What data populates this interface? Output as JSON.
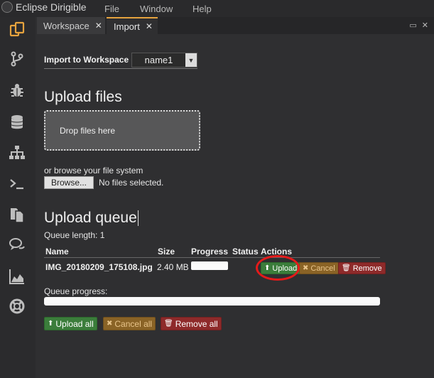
{
  "app": {
    "title": "Eclipse Dirigible"
  },
  "menu": {
    "items": [
      "File",
      "Window",
      "Help"
    ]
  },
  "leftbar": {
    "icons": [
      "workspace-icon",
      "git-branch-icon",
      "bug-icon",
      "database-icon",
      "sitemap-icon",
      "terminal-icon",
      "documents-icon",
      "chat-icon",
      "area-chart-icon",
      "lifebuoy-icon"
    ],
    "active_color": "#e6a33e"
  },
  "tabs": [
    {
      "label": "Workspace",
      "close": "✕"
    },
    {
      "label": "Import",
      "close": "✕"
    }
  ],
  "window_controls": {
    "restore": "▭",
    "close": "✕"
  },
  "import": {
    "label": "Import to Workspace",
    "workspace_value": "name1"
  },
  "upload": {
    "title": "Upload files",
    "dropzone": "Drop files here",
    "browse_prompt": "or browse your file system",
    "browse_button": "Browse...",
    "no_file": "No files selected."
  },
  "queue": {
    "title": "Upload queue",
    "length": "Queue length: 1",
    "columns": [
      "Name",
      "Size",
      "Progress",
      "Status",
      "Actions"
    ],
    "rows": [
      {
        "name": "IMG_20180209_175108.jpg",
        "size": "2.40 MB",
        "progress": 0
      }
    ],
    "row_actions": {
      "upload": "Upload",
      "cancel": "Cancel",
      "remove": "Remove"
    },
    "progress_label": "Queue progress:",
    "overall_progress": 0,
    "bulk": {
      "upload_all": "Upload all",
      "cancel_all": "Cancel all",
      "remove_all": "Remove all"
    }
  },
  "colors": {
    "upload_green": "#3b7d3b",
    "cancel_orange": "#8a6326",
    "remove_red": "#8e2a2a",
    "annotation_red": "#e51a1a"
  }
}
